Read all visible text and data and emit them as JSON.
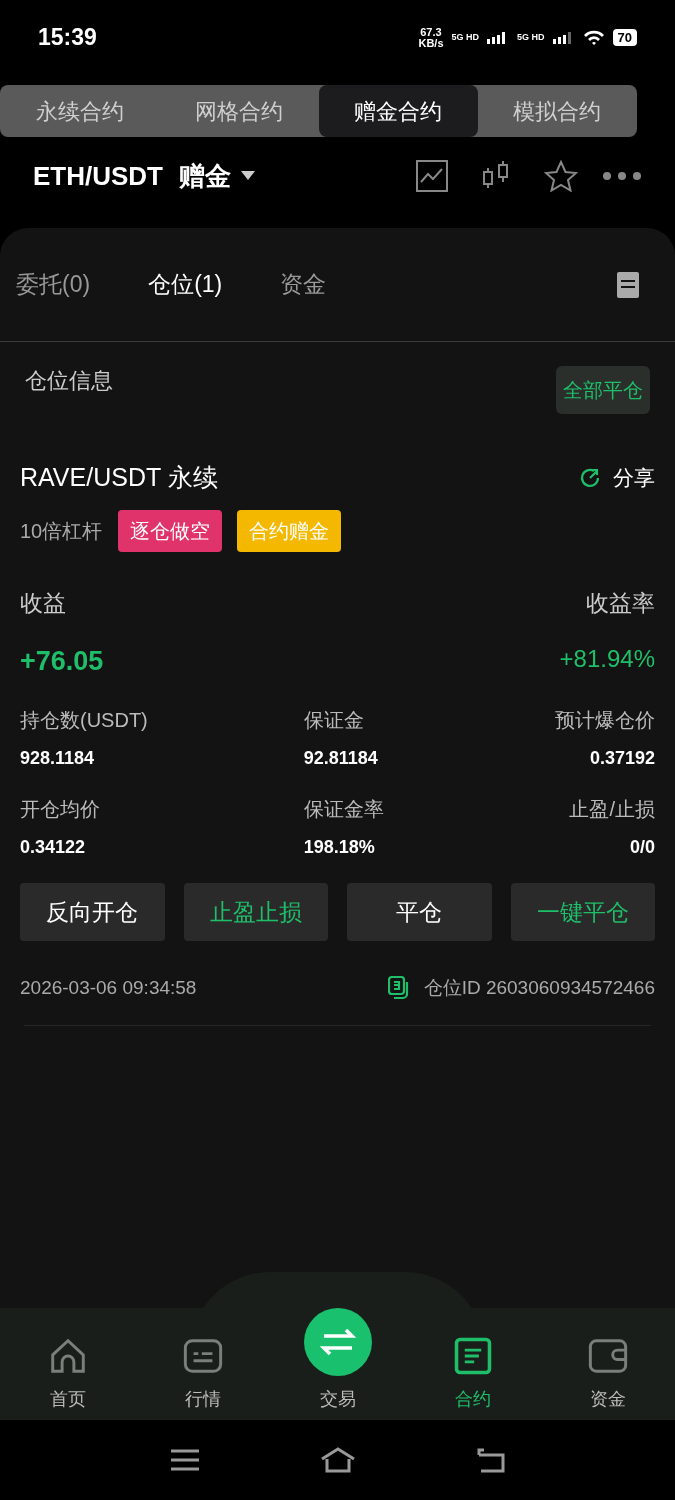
{
  "status_bar": {
    "time": "15:39",
    "speed": "67.3",
    "speed_unit": "KB/s",
    "sim1": "5G HD",
    "sim2": "5G HD",
    "battery": "70"
  },
  "contract_tabs": [
    {
      "label": "永续合约",
      "selected": false
    },
    {
      "label": "网格合约",
      "selected": false
    },
    {
      "label": "赠金合约",
      "selected": true
    },
    {
      "label": "模拟合约",
      "selected": false
    }
  ],
  "header": {
    "pair": "ETH/USDT",
    "mode": "赠金"
  },
  "panel_tabs": [
    {
      "label": "委托(0)",
      "selected": false
    },
    {
      "label": "仓位(1)",
      "selected": true
    },
    {
      "label": "资金",
      "selected": false
    }
  ],
  "section_title": "仓位信息",
  "close_all": "全部平仓",
  "position": {
    "symbol": "RAVE/USDT 永续",
    "share": "分享",
    "leverage": "10倍杠杆",
    "tags": [
      {
        "label": "逐仓做空",
        "color": "#e0336b"
      },
      {
        "label": "合约赠金",
        "color": "#f5b800"
      }
    ],
    "pnl_label": "收益",
    "pnl_rate_label": "收益率",
    "pnl": "+76.05",
    "pnl_rate": "+81.94%",
    "fields": [
      {
        "label": "持仓数(USDT)",
        "value": "928.1184"
      },
      {
        "label": "保证金",
        "value": "92.81184"
      },
      {
        "label": "预计爆仓价",
        "value": "0.37192"
      },
      {
        "label": "开仓均价",
        "value": "0.34122"
      },
      {
        "label": "保证金率",
        "value": "198.18%"
      },
      {
        "label": "止盈/止损",
        "value": "0/0"
      }
    ],
    "actions": [
      {
        "label": "反向开仓",
        "accent": false
      },
      {
        "label": "止盈止损",
        "accent": true
      },
      {
        "label": "平仓",
        "accent": false
      },
      {
        "label": "一键平仓",
        "accent": true
      }
    ],
    "time": "2026-03-06 09:34:58",
    "id_text": "仓位ID 2603060934572466"
  },
  "bottom_nav": [
    {
      "label": "首页",
      "kind": "home",
      "selected": false
    },
    {
      "label": "行情",
      "kind": "market",
      "selected": false
    },
    {
      "label": "交易",
      "kind": "trade",
      "selected": false
    },
    {
      "label": "合约",
      "kind": "contract",
      "selected": true
    },
    {
      "label": "资金",
      "kind": "wallet",
      "selected": false
    }
  ]
}
